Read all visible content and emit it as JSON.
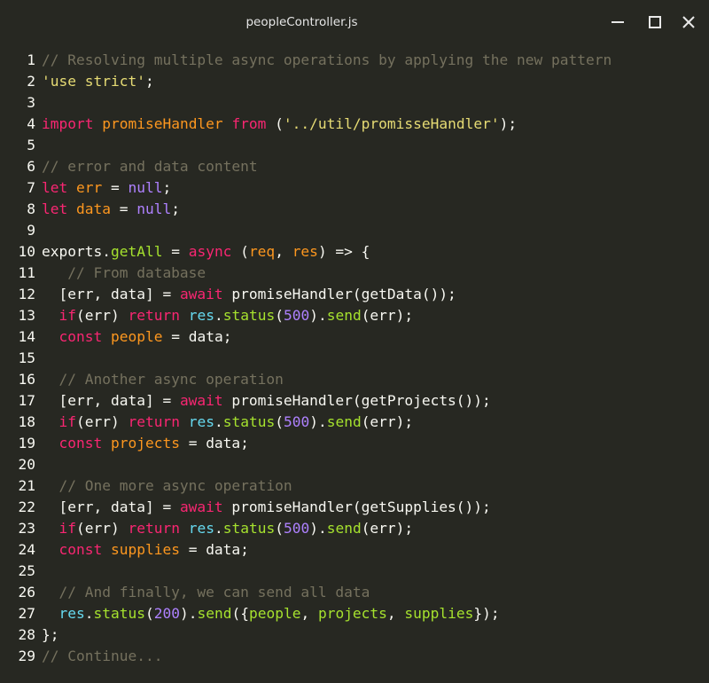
{
  "window": {
    "title": "peopleController.js",
    "controls": [
      "minimize-icon",
      "maximize-icon",
      "close-icon"
    ]
  },
  "theme": {
    "background": "#272822",
    "comment": "#75715e",
    "string": "#e6db74",
    "keyword": "#f92672",
    "number": "#ae81ff",
    "function": "#a6e22e",
    "parameter": "#fd971f",
    "plain": "#f8f8f2"
  },
  "code": [
    {
      "n": "1",
      "tokens": [
        [
          "comment",
          "// Resolving multiple async operations by applying the new pattern"
        ]
      ]
    },
    {
      "n": "2",
      "tokens": [
        [
          "string",
          "'use strict'"
        ],
        [
          "plain",
          ";"
        ]
      ]
    },
    {
      "n": "3",
      "tokens": []
    },
    {
      "n": "4",
      "tokens": [
        [
          "keyword",
          "import"
        ],
        [
          "plain",
          " "
        ],
        [
          "var",
          "promiseHandler"
        ],
        [
          "plain",
          " "
        ],
        [
          "keyword",
          "from"
        ],
        [
          "plain",
          " ("
        ],
        [
          "string",
          "'../util/promisseHandler'"
        ],
        [
          "plain",
          ");"
        ]
      ]
    },
    {
      "n": "5",
      "tokens": []
    },
    {
      "n": "6",
      "tokens": [
        [
          "comment",
          "// error and data content"
        ]
      ]
    },
    {
      "n": "7",
      "tokens": [
        [
          "keyword",
          "let"
        ],
        [
          "plain",
          " "
        ],
        [
          "var",
          "err"
        ],
        [
          "plain",
          " = "
        ],
        [
          "num",
          "null"
        ],
        [
          "plain",
          ";"
        ]
      ]
    },
    {
      "n": "8",
      "tokens": [
        [
          "keyword",
          "let"
        ],
        [
          "plain",
          " "
        ],
        [
          "var",
          "data"
        ],
        [
          "plain",
          " = "
        ],
        [
          "num",
          "null"
        ],
        [
          "plain",
          ";"
        ]
      ]
    },
    {
      "n": "9",
      "tokens": []
    },
    {
      "n": "10",
      "tokens": [
        [
          "plain",
          "exports."
        ],
        [
          "func",
          "getAll"
        ],
        [
          "plain",
          " = "
        ],
        [
          "keyword",
          "async"
        ],
        [
          "plain",
          " ("
        ],
        [
          "param",
          "req"
        ],
        [
          "plain",
          ", "
        ],
        [
          "param",
          "res"
        ],
        [
          "plain",
          ") => {"
        ]
      ]
    },
    {
      "n": "11",
      "tokens": [
        [
          "comment",
          "   // From database"
        ]
      ]
    },
    {
      "n": "12",
      "tokens": [
        [
          "plain",
          "  [err, data] = "
        ],
        [
          "keyword",
          "await"
        ],
        [
          "plain",
          " promiseHandler(getData());"
        ]
      ]
    },
    {
      "n": "13",
      "tokens": [
        [
          "plain",
          "  "
        ],
        [
          "keyword",
          "if"
        ],
        [
          "plain",
          "(err) "
        ],
        [
          "keyword",
          "return"
        ],
        [
          "plain",
          " "
        ],
        [
          "ident",
          "res"
        ],
        [
          "plain",
          "."
        ],
        [
          "func",
          "status"
        ],
        [
          "plain",
          "("
        ],
        [
          "num",
          "500"
        ],
        [
          "plain",
          ")."
        ],
        [
          "func",
          "send"
        ],
        [
          "plain",
          "(err);"
        ]
      ]
    },
    {
      "n": "14",
      "tokens": [
        [
          "plain",
          "  "
        ],
        [
          "keyword",
          "const"
        ],
        [
          "plain",
          " "
        ],
        [
          "var",
          "people"
        ],
        [
          "plain",
          " = data;"
        ]
      ]
    },
    {
      "n": "15",
      "tokens": []
    },
    {
      "n": "16",
      "tokens": [
        [
          "comment",
          "  // Another async operation"
        ]
      ]
    },
    {
      "n": "17",
      "tokens": [
        [
          "plain",
          "  [err, data] = "
        ],
        [
          "keyword",
          "await"
        ],
        [
          "plain",
          " promiseHandler(getProjects());"
        ]
      ]
    },
    {
      "n": "18",
      "tokens": [
        [
          "plain",
          "  "
        ],
        [
          "keyword",
          "if"
        ],
        [
          "plain",
          "(err) "
        ],
        [
          "keyword",
          "return"
        ],
        [
          "plain",
          " "
        ],
        [
          "ident",
          "res"
        ],
        [
          "plain",
          "."
        ],
        [
          "func",
          "status"
        ],
        [
          "plain",
          "("
        ],
        [
          "num",
          "500"
        ],
        [
          "plain",
          ")."
        ],
        [
          "func",
          "send"
        ],
        [
          "plain",
          "(err);"
        ]
      ]
    },
    {
      "n": "19",
      "tokens": [
        [
          "plain",
          "  "
        ],
        [
          "keyword",
          "const"
        ],
        [
          "plain",
          " "
        ],
        [
          "var",
          "projects"
        ],
        [
          "plain",
          " = data;"
        ]
      ]
    },
    {
      "n": "20",
      "tokens": []
    },
    {
      "n": "21",
      "tokens": [
        [
          "comment",
          "  // One more async operation"
        ]
      ]
    },
    {
      "n": "22",
      "tokens": [
        [
          "plain",
          "  [err, data] = "
        ],
        [
          "keyword",
          "await"
        ],
        [
          "plain",
          " promiseHandler(getSupplies());"
        ]
      ]
    },
    {
      "n": "23",
      "tokens": [
        [
          "plain",
          "  "
        ],
        [
          "keyword",
          "if"
        ],
        [
          "plain",
          "(err) "
        ],
        [
          "keyword",
          "return"
        ],
        [
          "plain",
          " "
        ],
        [
          "ident",
          "res"
        ],
        [
          "plain",
          "."
        ],
        [
          "func",
          "status"
        ],
        [
          "plain",
          "("
        ],
        [
          "num",
          "500"
        ],
        [
          "plain",
          ")."
        ],
        [
          "func",
          "send"
        ],
        [
          "plain",
          "(err);"
        ]
      ]
    },
    {
      "n": "24",
      "tokens": [
        [
          "plain",
          "  "
        ],
        [
          "keyword",
          "const"
        ],
        [
          "plain",
          " "
        ],
        [
          "var",
          "supplies"
        ],
        [
          "plain",
          " = data;"
        ]
      ]
    },
    {
      "n": "25",
      "tokens": []
    },
    {
      "n": "26",
      "tokens": [
        [
          "comment",
          "  // And finally, we can send all data"
        ]
      ]
    },
    {
      "n": "27",
      "tokens": [
        [
          "plain",
          "  "
        ],
        [
          "ident",
          "res"
        ],
        [
          "plain",
          "."
        ],
        [
          "func",
          "status"
        ],
        [
          "plain",
          "("
        ],
        [
          "num",
          "200"
        ],
        [
          "plain",
          ")."
        ],
        [
          "func",
          "send"
        ],
        [
          "plain",
          "({"
        ],
        [
          "func",
          "people"
        ],
        [
          "plain",
          ", "
        ],
        [
          "func",
          "projects"
        ],
        [
          "plain",
          ", "
        ],
        [
          "func",
          "supplies"
        ],
        [
          "plain",
          "});"
        ]
      ]
    },
    {
      "n": "28",
      "tokens": [
        [
          "plain",
          "};"
        ]
      ]
    },
    {
      "n": "29",
      "tokens": [
        [
          "comment",
          "// Continue..."
        ]
      ]
    }
  ]
}
